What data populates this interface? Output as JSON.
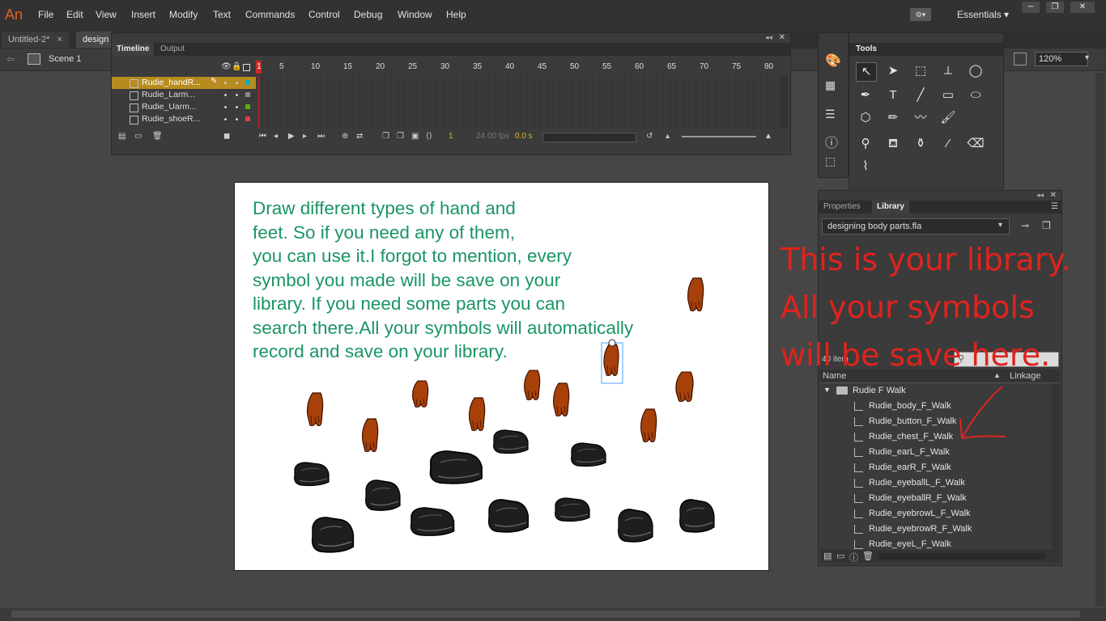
{
  "app": {
    "logo": "An"
  },
  "menu": [
    "File",
    "Edit",
    "View",
    "Insert",
    "Modify",
    "Text",
    "Commands",
    "Control",
    "Debug",
    "Window",
    "Help"
  ],
  "workspace": {
    "icon": "workspace-switcher-icon",
    "label": "Essentials ▾"
  },
  "window_controls": [
    "─",
    "❐",
    "✕"
  ],
  "doc_tabs": [
    {
      "label": "Untitled-2*",
      "close": "×"
    },
    {
      "label": "design",
      "close": ""
    }
  ],
  "editbar": {
    "scene": "Scene 1",
    "zoom": "120%"
  },
  "timeline": {
    "tabs": [
      "Timeline",
      "Output"
    ],
    "frame_numbers": [
      "1",
      "5",
      "10",
      "15",
      "20",
      "25",
      "30",
      "35",
      "40",
      "45",
      "50",
      "55",
      "60",
      "65",
      "70",
      "75",
      "80"
    ],
    "layers": [
      {
        "name": "Rudie_handR...",
        "color": "#00b0c0",
        "selected": true
      },
      {
        "name": "Rudie_Larm...",
        "color": "#888888",
        "selected": false
      },
      {
        "name": "Rudie_Uarm...",
        "color": "#58b000",
        "selected": false
      },
      {
        "name": "Rudie_shoeR...",
        "color": "#e04040",
        "selected": false
      }
    ],
    "current_frame": "1",
    "fps": "24.00 fps",
    "time": "0.0 s"
  },
  "stage": {
    "text_lines": [
      "Draw different types of hand and",
      "feet. So if you need any of them,",
      "you can use it.I forgot to mention, every",
      "symbol you made will be save on your",
      "library. If you need some parts you can",
      "search there.All your symbols will automatically",
      "record and save on your library."
    ],
    "hand_color": "#a8400a",
    "shoe_color": "#222222"
  },
  "tools": {
    "title": "Tools"
  },
  "library": {
    "tabs": [
      "Properties",
      "Library"
    ],
    "document": "designing body parts.fla",
    "count": "40 item",
    "columns": {
      "name": "Name",
      "linkage": "Linkage"
    },
    "folder": "Rudie F Walk",
    "items": [
      "Rudie_body_F_Walk",
      "Rudie_button_F_Walk",
      "Rudie_chest_F_Walk",
      "Rudie_earL_F_Walk",
      "Rudie_earR_F_Walk",
      "Rudie_eyeballL_F_Walk",
      "Rudie_eyeballR_F_Walk",
      "Rudie_eyebrowL_F_Walk",
      "Rudie_eyebrowR_F_Walk",
      "Rudie_eyeL_F_Walk"
    ]
  },
  "annotation": {
    "lines": [
      "This is your library.",
      "All your symbols",
      "will be save here."
    ],
    "color": "#e0231e"
  }
}
